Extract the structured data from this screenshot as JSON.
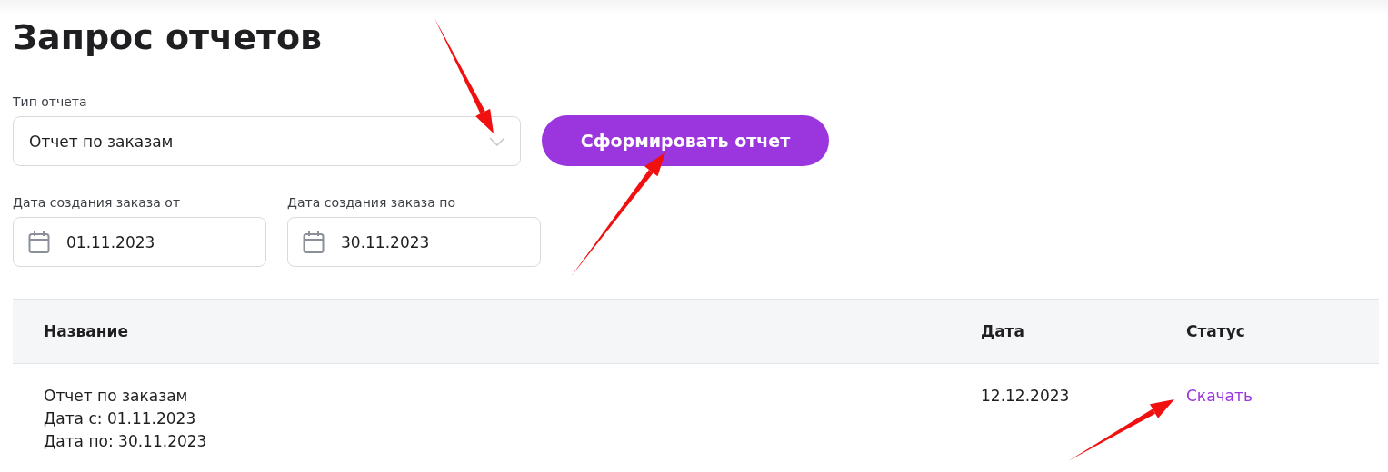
{
  "title": "Запрос отчетов",
  "report_type": {
    "label": "Тип отчета",
    "value": "Отчет по заказам"
  },
  "generate_button": "Сформировать отчет",
  "date_from": {
    "label": "Дата создания заказа от",
    "value": "01.11.2023"
  },
  "date_to": {
    "label": "Дата создания заказа по",
    "value": "30.11.2023"
  },
  "table": {
    "columns": [
      "Название",
      "Дата",
      "Статус"
    ],
    "rows": [
      {
        "name_lines": [
          "Отчет по заказам",
          "Дата с: 01.11.2023",
          "Дата по: 30.11.2023"
        ],
        "date": "12.12.2023",
        "status": "Скачать"
      }
    ]
  }
}
